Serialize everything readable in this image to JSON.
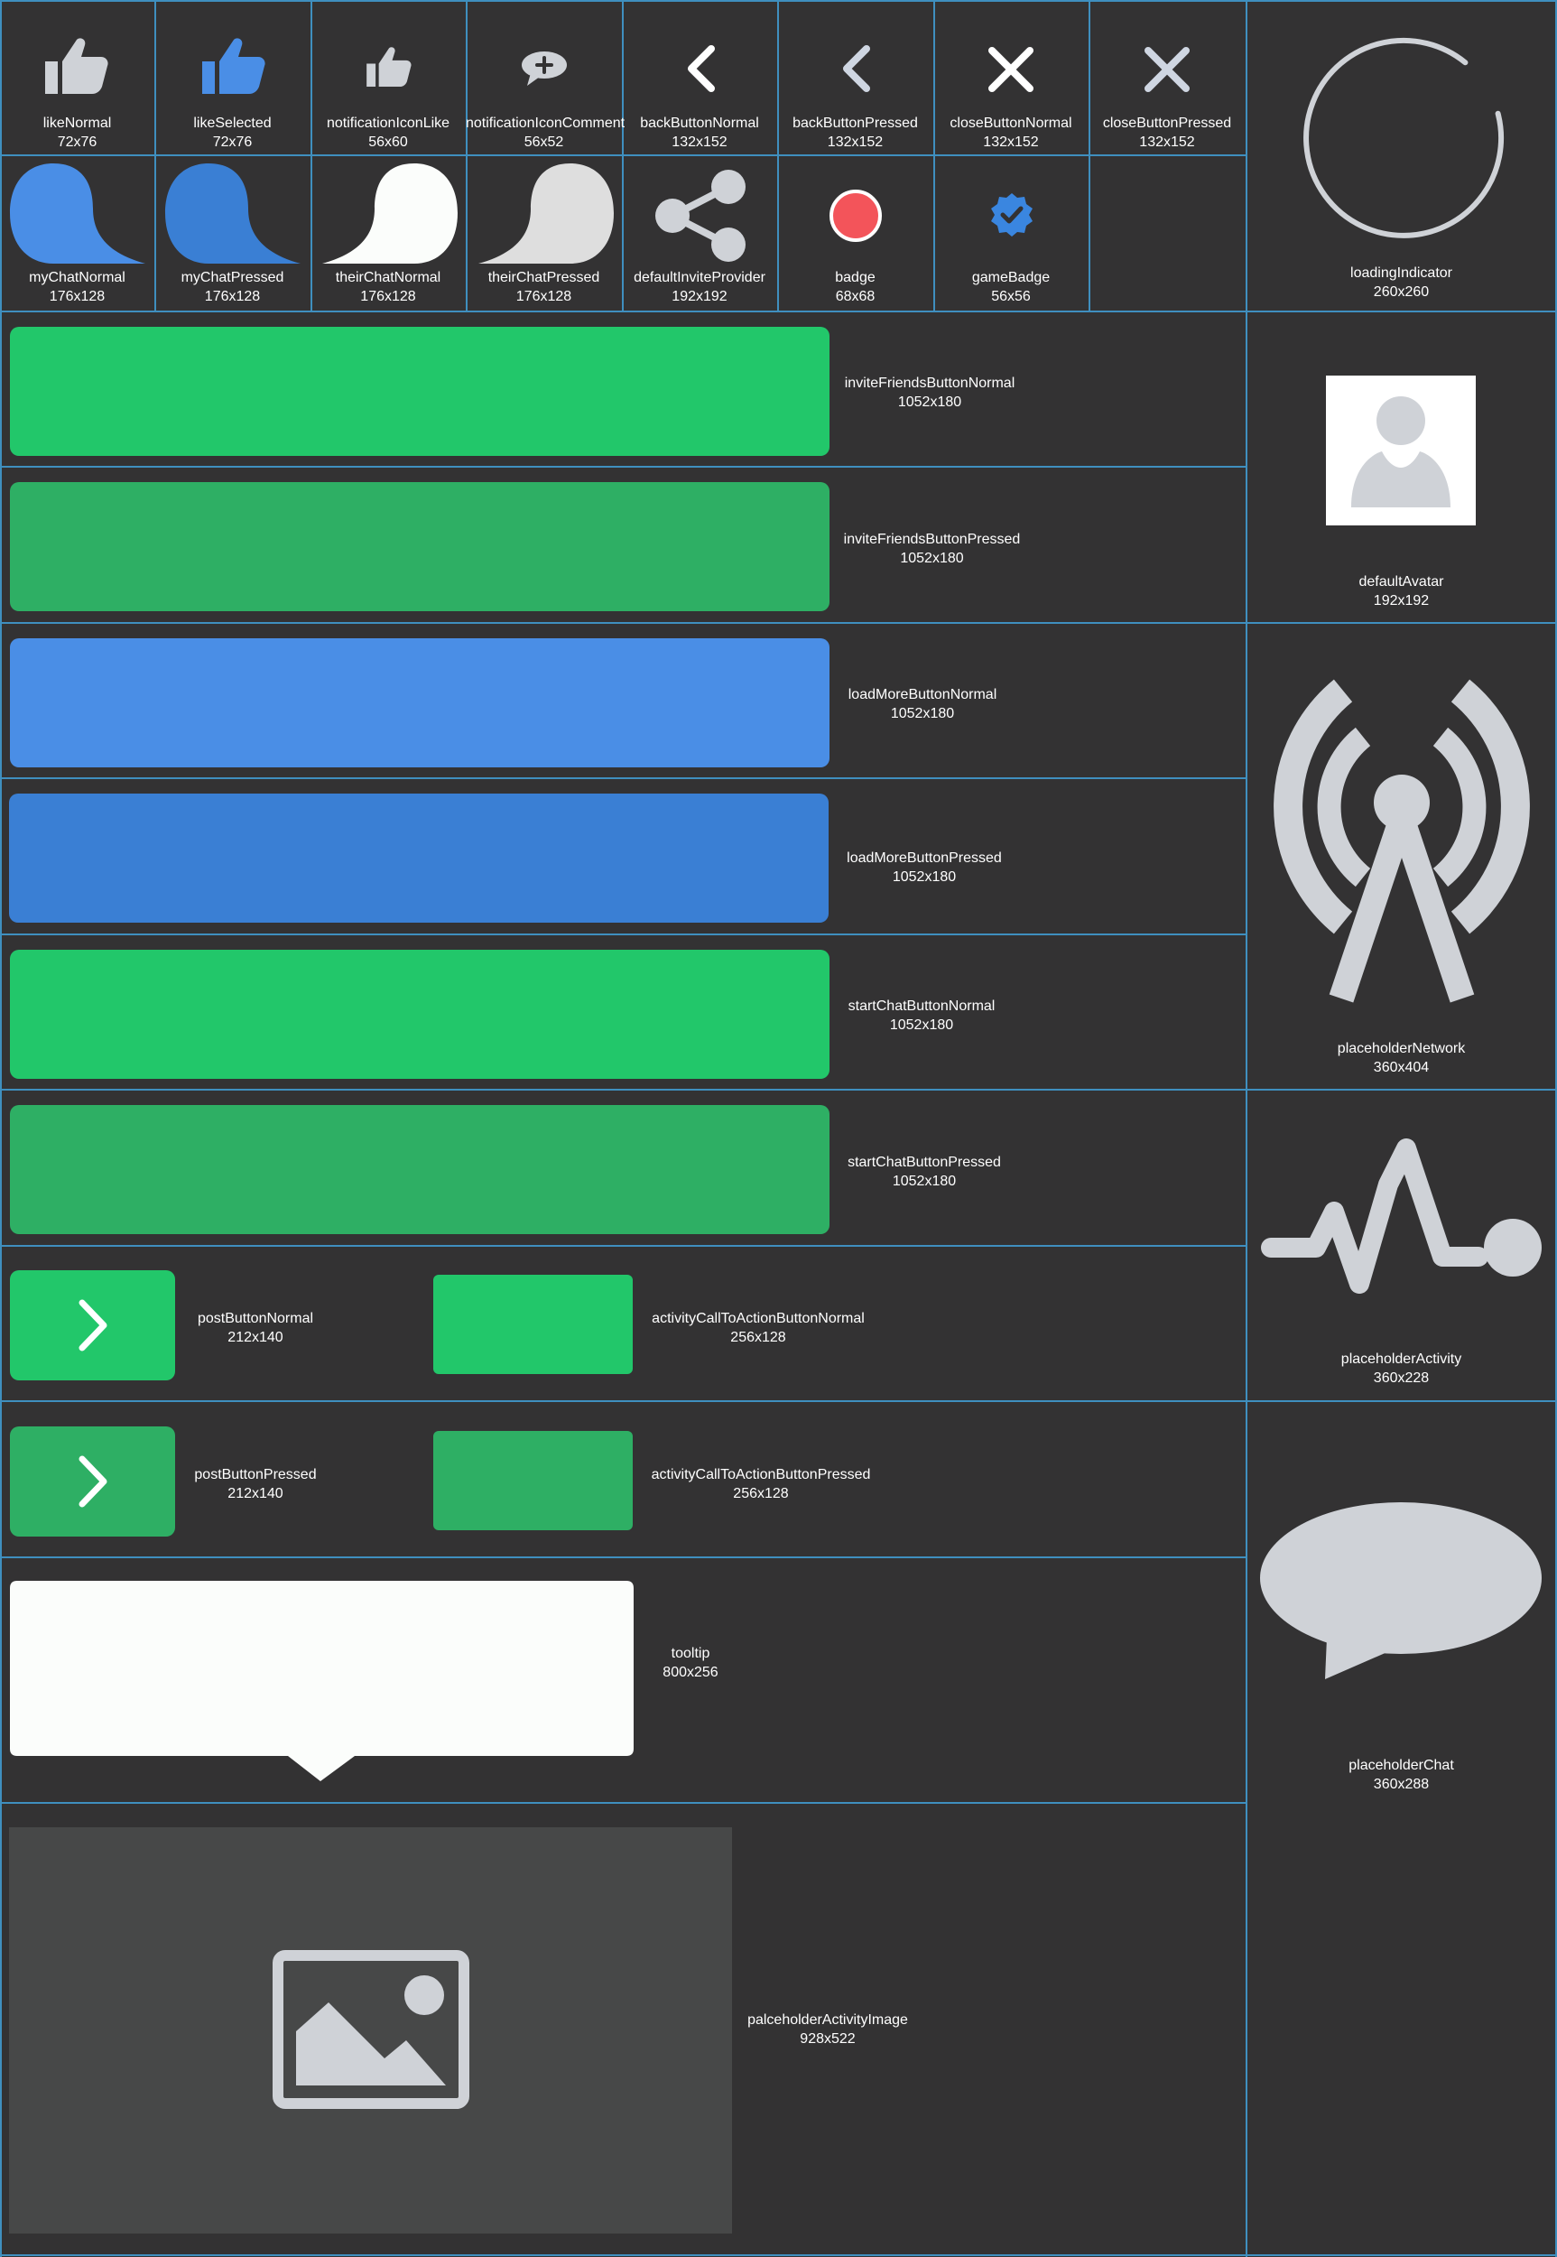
{
  "assets": {
    "likeNormal": {
      "name": "likeNormal",
      "size": "72x76"
    },
    "likeSelected": {
      "name": "likeSelected",
      "size": "72x76"
    },
    "notificationIconLike": {
      "name": "notificationIconLike",
      "size": "56x60"
    },
    "notificationIconComment": {
      "name": "notificationIconComment",
      "size": "56x52"
    },
    "backButtonNormal": {
      "name": "backButtonNormal",
      "size": "132x152"
    },
    "backButtonPressed": {
      "name": "backButtonPressed",
      "size": "132x152"
    },
    "closeButtonNormal": {
      "name": "closeButtonNormal",
      "size": "132x152"
    },
    "closeButtonPressed": {
      "name": "closeButtonPressed",
      "size": "132x152"
    },
    "loadingIndicator": {
      "name": "loadingIndicator",
      "size": "260x260"
    },
    "myChatNormal": {
      "name": "myChatNormal",
      "size": "176x128"
    },
    "myChatPressed": {
      "name": "myChatPressed",
      "size": "176x128"
    },
    "theirChatNormal": {
      "name": "theirChatNormal",
      "size": "176x128"
    },
    "theirChatPressed": {
      "name": "theirChatPressed",
      "size": "176x128"
    },
    "defaultInviteProvider": {
      "name": "defaultInviteProvider",
      "size": "192x192"
    },
    "badge": {
      "name": "badge",
      "size": "68x68"
    },
    "gameBadge": {
      "name": "gameBadge",
      "size": "56x56"
    },
    "inviteFriendsButtonNormal": {
      "name": "inviteFriendsButtonNormal",
      "size": "1052x180"
    },
    "inviteFriendsButtonPressed": {
      "name": "inviteFriendsButtonPressed",
      "size": "1052x180"
    },
    "defaultAvatar": {
      "name": "defaultAvatar",
      "size": "192x192"
    },
    "loadMoreButtonNormal": {
      "name": "loadMoreButtonNormal",
      "size": "1052x180"
    },
    "loadMoreButtonPressed": {
      "name": "loadMoreButtonPressed",
      "size": "1052x180"
    },
    "startChatButtonNormal": {
      "name": "startChatButtonNormal",
      "size": "1052x180"
    },
    "startChatButtonPressed": {
      "name": "startChatButtonPressed",
      "size": "1052x180"
    },
    "placeholderNetwork": {
      "name": "placeholderNetwork",
      "size": "360x404"
    },
    "placeholderActivity": {
      "name": "placeholderActivity",
      "size": "360x228"
    },
    "postButtonNormal": {
      "name": "postButtonNormal",
      "size": "212x140"
    },
    "activityCallToActionButtonNormal": {
      "name": "activityCallToActionButtonNormal",
      "size": "256x128"
    },
    "postButtonPressed": {
      "name": "postButtonPressed",
      "size": "212x140"
    },
    "activityCallToActionButtonPressed": {
      "name": "activityCallToActionButtonPressed",
      "size": "256x128"
    },
    "tooltip": {
      "name": "tooltip",
      "size": "800x256"
    },
    "placeholderChat": {
      "name": "placeholderChat",
      "size": "360x288"
    },
    "palceholderActivityImage": {
      "name": "palceholderActivityImage",
      "size": "928x522"
    }
  },
  "colors": {
    "background": "#333233",
    "gridLine": "#3f8fbf",
    "green": "#22c76a",
    "greenPressed": "#2eaf64",
    "blue": "#4a8ee6",
    "bluePressed": "#3a7fd4",
    "gray": "#cfd2d7",
    "badgeRed": "#f3545a",
    "white": "#ffffff",
    "imageBg": "#474848"
  },
  "icons": {
    "like": "thumbs-up-icon",
    "comment": "comment-plus-icon",
    "back": "chevron-left-icon",
    "close": "close-icon",
    "share": "share-icon",
    "verified": "verified-badge-icon",
    "avatar": "user-avatar-icon",
    "network": "antenna-icon",
    "activity": "pulse-icon",
    "chat": "speech-bubble-icon",
    "image": "image-icon",
    "arrow": "chevron-right-icon"
  }
}
